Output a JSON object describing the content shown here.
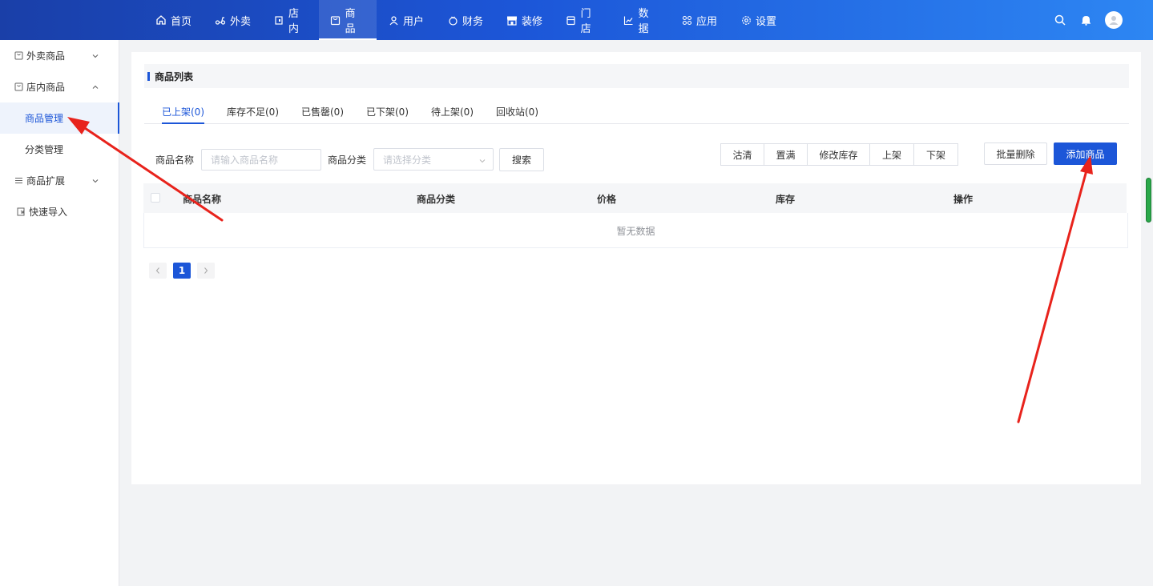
{
  "colors": {
    "primary": "#1c56d8",
    "annotation_arrow": "#e8231c"
  },
  "topnav": {
    "items": [
      {
        "label": "首页",
        "icon": "home-icon"
      },
      {
        "label": "外卖",
        "icon": "scooter-icon"
      },
      {
        "label": "店内",
        "icon": "store-icon"
      },
      {
        "label": "商品",
        "icon": "goods-icon",
        "active": true
      },
      {
        "label": "用户",
        "icon": "user-icon"
      },
      {
        "label": "财务",
        "icon": "wallet-icon"
      },
      {
        "label": "装修",
        "icon": "shop-decor-icon"
      },
      {
        "label": "门店",
        "icon": "building-icon"
      },
      {
        "label": "数据",
        "icon": "chart-icon"
      },
      {
        "label": "应用",
        "icon": "apps-icon"
      },
      {
        "label": "设置",
        "icon": "gear-icon"
      }
    ]
  },
  "sidebar": {
    "items": [
      {
        "label": "外卖商品",
        "icon": "bag-icon",
        "chevron": "down"
      },
      {
        "label": "店内商品",
        "icon": "bag-icon",
        "chevron": "up"
      },
      {
        "label": "商品管理",
        "sub": true,
        "active": true
      },
      {
        "label": "分类管理",
        "sub": true
      },
      {
        "label": "商品扩展",
        "icon": "list-icon",
        "chevron": "down"
      },
      {
        "label": "快速导入",
        "icon": "import-icon"
      }
    ]
  },
  "card": {
    "title": "商品列表",
    "tabs": [
      "已上架(0)",
      "库存不足(0)",
      "已售罄(0)",
      "已下架(0)",
      "待上架(0)",
      "回收站(0)"
    ],
    "filter": {
      "name_label": "商品名称",
      "name_placeholder": "请输入商品名称",
      "category_label": "商品分类",
      "category_placeholder": "请选择分类",
      "search_label": "搜索"
    },
    "actions": [
      "沽清",
      "置满",
      "修改库存",
      "上架",
      "下架"
    ],
    "batch_delete": "批量删除",
    "add_goods": "添加商品",
    "table": {
      "columns": [
        "商品名称",
        "商品分类",
        "价格",
        "库存",
        "操作"
      ],
      "empty_text": "暂无数据"
    },
    "pagination": {
      "current": "1"
    }
  }
}
